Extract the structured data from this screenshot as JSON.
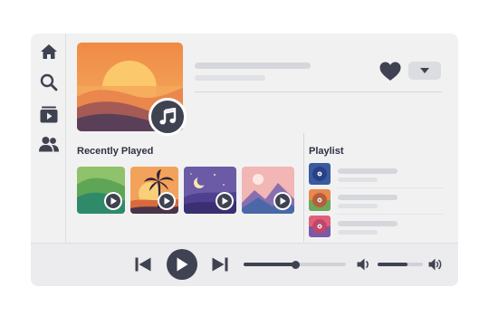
{
  "sidebar": {
    "items": [
      {
        "name": "home",
        "icon": "home-icon"
      },
      {
        "name": "search",
        "icon": "search-icon"
      },
      {
        "name": "library",
        "icon": "library-play-icon"
      },
      {
        "name": "friends",
        "icon": "users-icon"
      }
    ]
  },
  "now_playing": {
    "art": "sunset-landscape-art",
    "badge_icon": "music-note-icon",
    "liked_icon": "heart-icon",
    "menu_icon": "caret-down-icon"
  },
  "recently_played": {
    "title": "Recently Played",
    "items": [
      {
        "art": "green-hills-art"
      },
      {
        "art": "palm-sunset-art"
      },
      {
        "art": "night-moon-art"
      },
      {
        "art": "pink-mountains-art"
      }
    ]
  },
  "playlist": {
    "title": "Playlist",
    "items": [
      {
        "art": "vinyl-blue-art"
      },
      {
        "art": "vinyl-orange-art"
      },
      {
        "art": "vinyl-pink-art"
      }
    ]
  },
  "player": {
    "progress": 0.51,
    "volume": 0.65,
    "icons": [
      "skip-back-icon",
      "play-icon",
      "skip-forward-icon",
      "volume-low-icon",
      "volume-high-icon"
    ]
  },
  "colors": {
    "accent": "#3f4250",
    "window_bg": "#f1f1f2",
    "skeleton": "#d6d7dc"
  }
}
